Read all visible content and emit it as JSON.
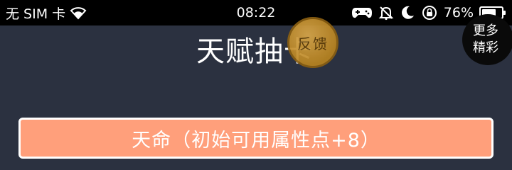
{
  "status_bar": {
    "carrier": "无 SIM 卡",
    "time": "08:22",
    "battery_percent": "76%",
    "battery_level": 0.76,
    "icons": [
      "wifi-icon",
      "gamepad-icon",
      "mute-bell-icon",
      "moon-icon",
      "rotation-lock-icon",
      "battery-icon"
    ]
  },
  "page": {
    "title": "天赋抽卡"
  },
  "feedback_badge": {
    "label": "反馈"
  },
  "more_button": {
    "line1": "更多",
    "line2": "精彩"
  },
  "talent_option": {
    "label": "天命（初始可用属性点+8）",
    "color": "#ff9f7b"
  },
  "colors": {
    "background": "#2b3140",
    "status_bar": "#000000",
    "badge_gold": "#c99433"
  }
}
